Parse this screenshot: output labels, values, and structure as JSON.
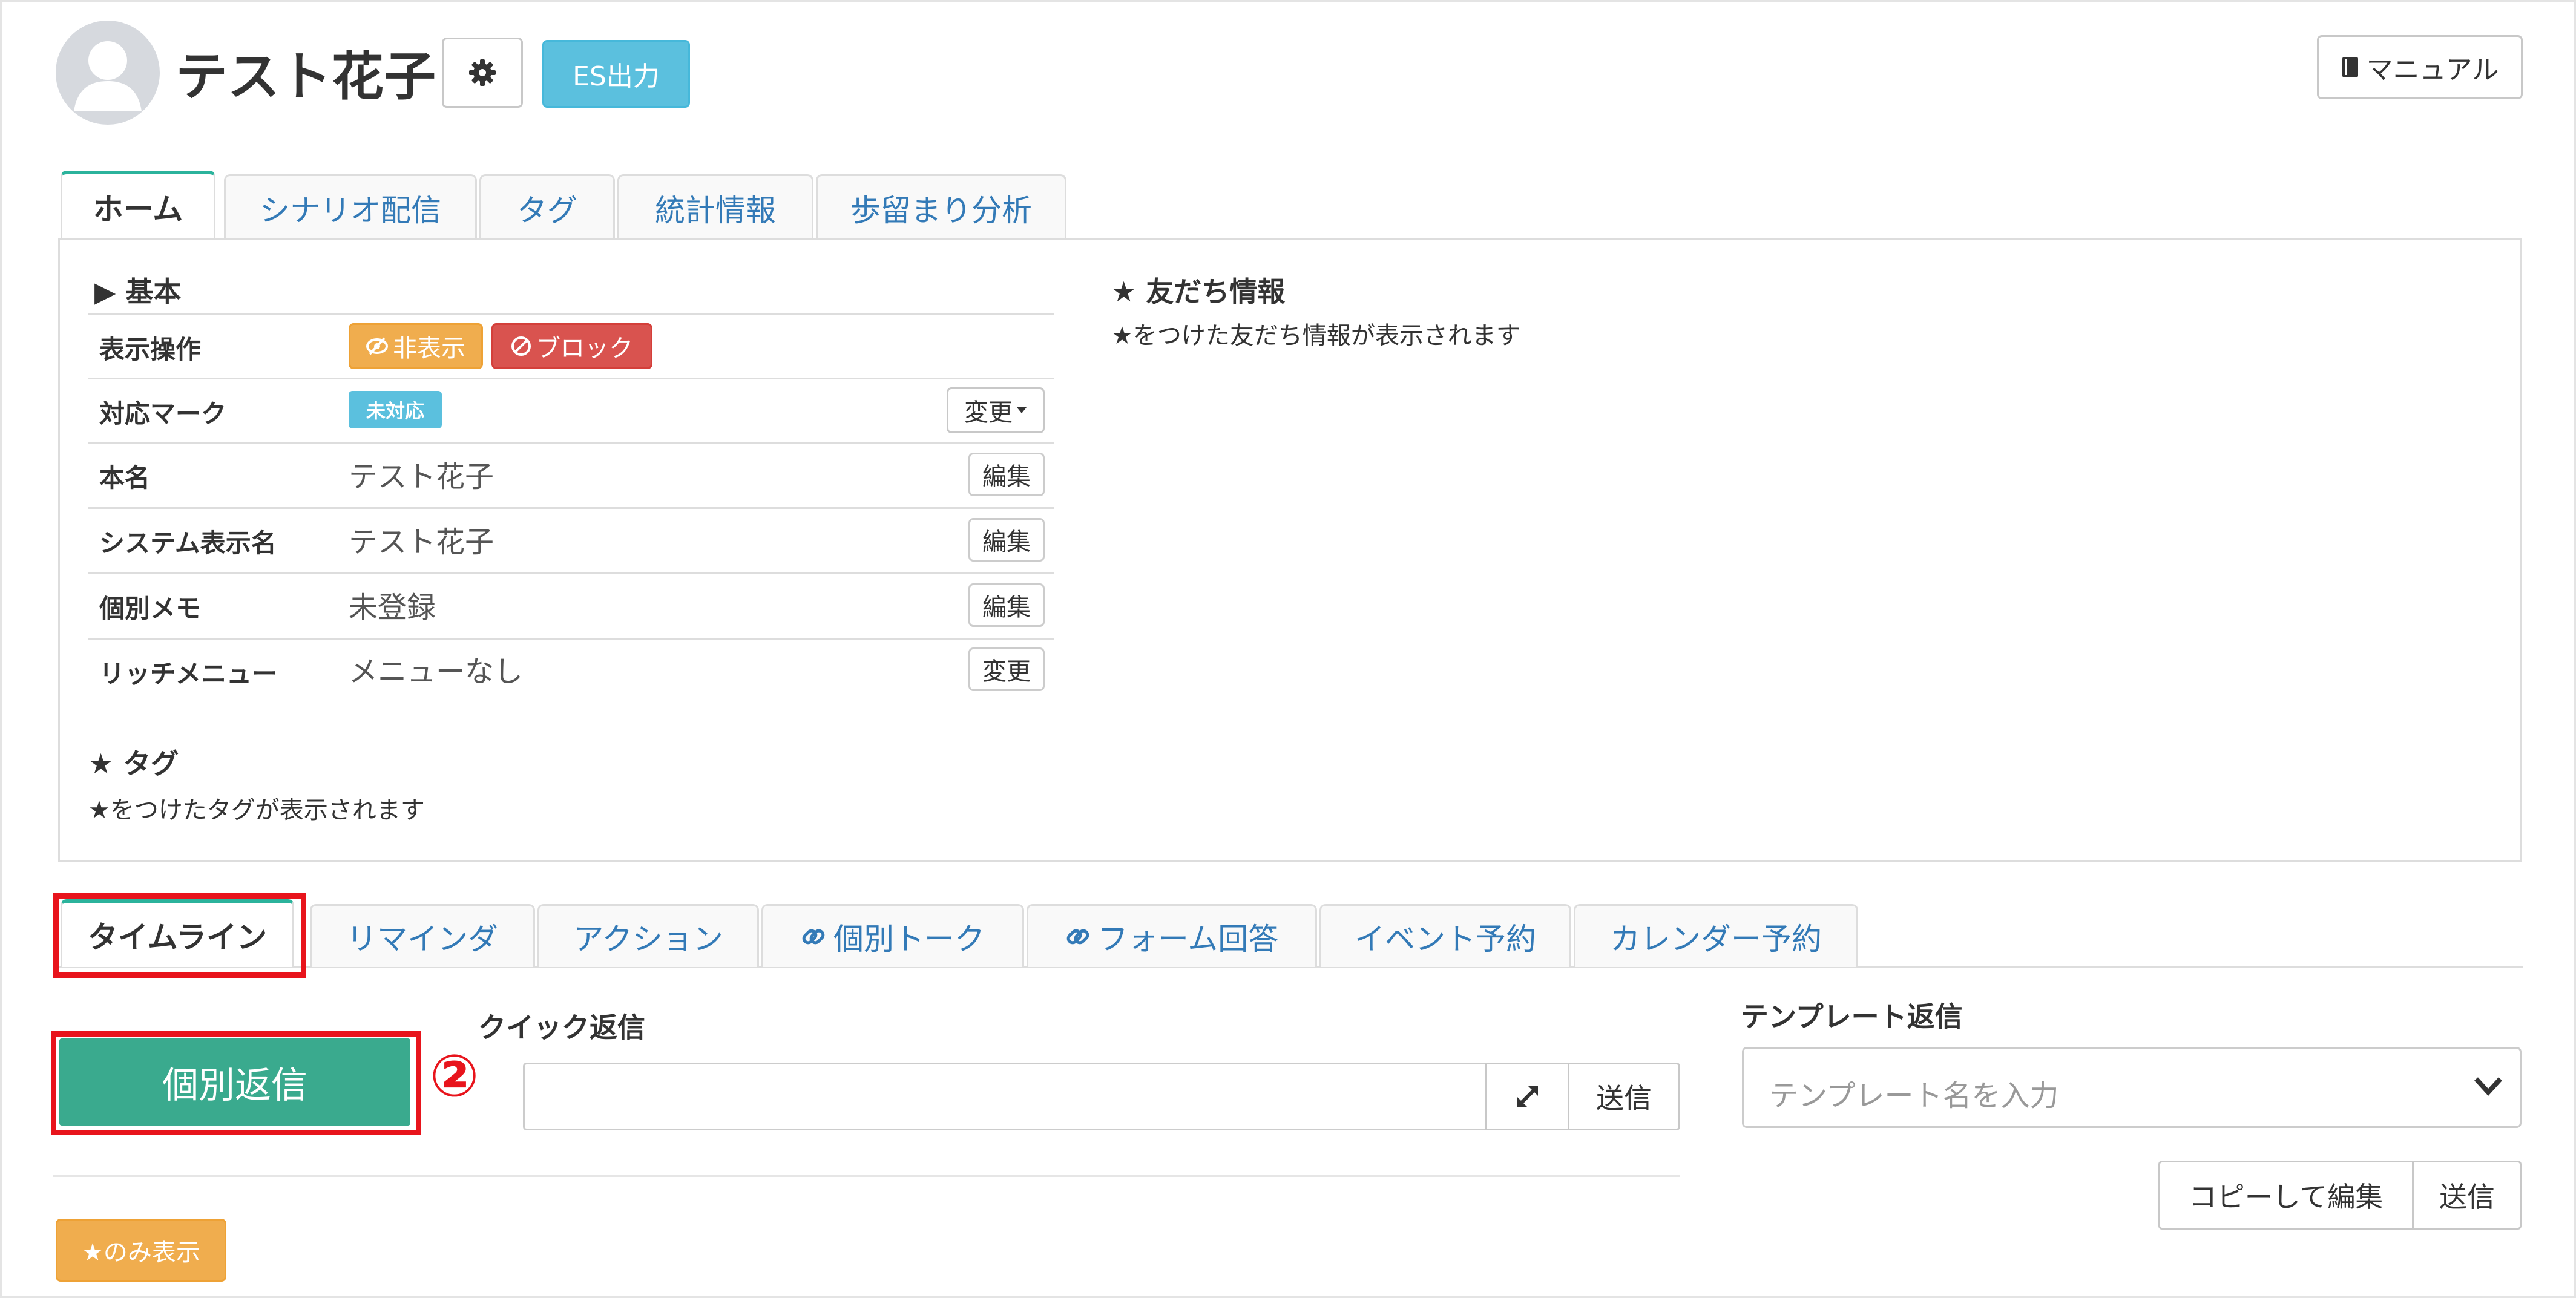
{
  "header": {
    "user_name": "テスト花子",
    "es_button": "ES出力",
    "manual_button": "マニュアル"
  },
  "top_tabs": [
    {
      "label": "ホーム",
      "active": true
    },
    {
      "label": "シナリオ配信"
    },
    {
      "label": "タグ"
    },
    {
      "label": "統計情報"
    },
    {
      "label": "歩留まり分析"
    }
  ],
  "basic": {
    "title": "▶ 基本",
    "rows": [
      {
        "label": "表示操作"
      },
      {
        "label": "対応マーク",
        "badge": "未対応",
        "button": "変更"
      },
      {
        "label": "本名",
        "value": "テスト花子",
        "button": "編集"
      },
      {
        "label": "システム表示名",
        "value": "テスト花子",
        "button": "編集"
      },
      {
        "label": "個別メモ",
        "value": "未登録",
        "button": "編集"
      },
      {
        "label": "リッチメニュー",
        "value": "メニューなし",
        "button": "変更"
      }
    ],
    "hide_button": "非表示",
    "block_button": "ブロック"
  },
  "friend_info": {
    "title": "★ 友だち情報",
    "note": "★をつけた友だち情報が表示されます"
  },
  "tags": {
    "title": "★ タグ",
    "note": "★をつけたタグが表示されます"
  },
  "bottom_tabs": [
    {
      "label": "タイムライン",
      "active": true
    },
    {
      "label": "リマインダ"
    },
    {
      "label": "アクション"
    },
    {
      "label": "個別トーク",
      "link_icon": true
    },
    {
      "label": "フォーム回答",
      "link_icon": true
    },
    {
      "label": "イベント予約"
    },
    {
      "label": "カレンダー予約"
    }
  ],
  "reply": {
    "individual_reply_button": "個別返信",
    "annotation": "②",
    "quick_reply_title": "クイック返信",
    "quick_send": "送信",
    "template_title": "テンプレート返信",
    "template_placeholder": "テンプレート名を入力",
    "copy_edit_button": "コピーして編集",
    "template_send": "送信",
    "star_only_button": "★のみ表示"
  },
  "colors": {
    "accent_green": "#3aaa8e",
    "es_blue": "#5bc0de",
    "hide_orange": "#f0ad4e",
    "block_red": "#d9534f",
    "highlight_red": "#e8141c",
    "link_blue": "#337ab7"
  }
}
